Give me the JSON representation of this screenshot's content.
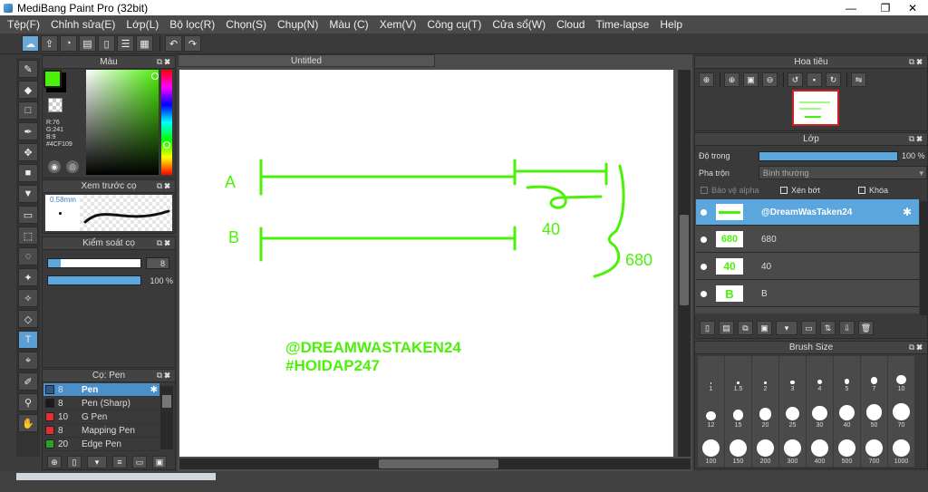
{
  "window": {
    "title": "MediBang Paint Pro (32bit)",
    "min": "—",
    "max": "❐",
    "close": "✕"
  },
  "menu": [
    "Tệp(F)",
    "Chỉnh sửa(E)",
    "Lớp(L)",
    "Bộ lọc(R)",
    "Chọn(S)",
    "Chụp(N)",
    "Màu (C)",
    "Xem(V)",
    "Công cụ(T)",
    "Cửa sổ(W)",
    "Cloud",
    "Time-lapse",
    "Help"
  ],
  "toolbar": {
    "icons": [
      "cloud-save-icon",
      "share-icon",
      "comment-icon",
      "chat-icon",
      "page-icon",
      "list-icon",
      "grid-icon"
    ],
    "undo": "↶",
    "redo": "↷"
  },
  "tools": [
    "✎",
    "◆",
    "□",
    "✒",
    "✥",
    "■",
    "▼",
    "▭",
    "⬚",
    "◌",
    "✦",
    "✧",
    "◇",
    "T",
    "⌖",
    "✐",
    "⚲",
    "✋"
  ],
  "color_panel": {
    "title": "Màu",
    "r": "R:76",
    "g": "G:241",
    "b": "B:9",
    "hex": "#4CF109",
    "primary": "#4CF109"
  },
  "brush_preview": {
    "title": "Xem trước cọ",
    "size": "0.58mm"
  },
  "brush_control": {
    "title": "Kiểm soát cọ",
    "size_value": "8",
    "opacity_value": "100 %"
  },
  "brush_list": {
    "title": "Cọ: Pen",
    "items": [
      {
        "size": "8",
        "name": "Pen",
        "color": "#2d5a8a",
        "selected": true
      },
      {
        "size": "8",
        "name": "Pen (Sharp)",
        "color": "#1a1a1a",
        "selected": false
      },
      {
        "size": "10",
        "name": "G Pen",
        "color": "#e03030",
        "selected": false
      },
      {
        "size": "8",
        "name": "Mapping Pen",
        "color": "#e03030",
        "selected": false
      },
      {
        "size": "20",
        "name": "Edge Pen",
        "color": "#2aa02a",
        "selected": false
      }
    ]
  },
  "document": {
    "tab": "Untitled"
  },
  "canvas_text": {
    "a": "A",
    "b": "B",
    "n40": "40",
    "n680": "680",
    "watermark1": "@DREAMWASTAKEN24",
    "watermark2": "#HOIDAP247",
    "stroke_color": "#4CF109"
  },
  "navigator": {
    "title": "Hoa tiêu"
  },
  "layers": {
    "title": "Lớp",
    "opacity_label": "Độ trong",
    "opacity_value": "100 %",
    "blend_label": "Pha trộn",
    "blend_value": "Bình thường",
    "protect_alpha": "Bảo vệ alpha",
    "clip": "Xén bớt",
    "lock": "Khóa",
    "items": [
      {
        "name": "@DreamWasTaken24",
        "thumb": "",
        "selected": true
      },
      {
        "name": "680",
        "thumb": "680",
        "selected": false
      },
      {
        "name": "40",
        "thumb": "40",
        "selected": false
      },
      {
        "name": "B",
        "thumb": "B",
        "selected": false
      }
    ]
  },
  "brush_size": {
    "title": "Brush Size",
    "sizes": [
      "1",
      "1.5",
      "2",
      "3",
      "4",
      "5",
      "7",
      "10",
      "12",
      "15",
      "20",
      "25",
      "30",
      "40",
      "50",
      "70",
      "100",
      "150",
      "200",
      "300",
      "400",
      "500",
      "700",
      "1000"
    ]
  }
}
